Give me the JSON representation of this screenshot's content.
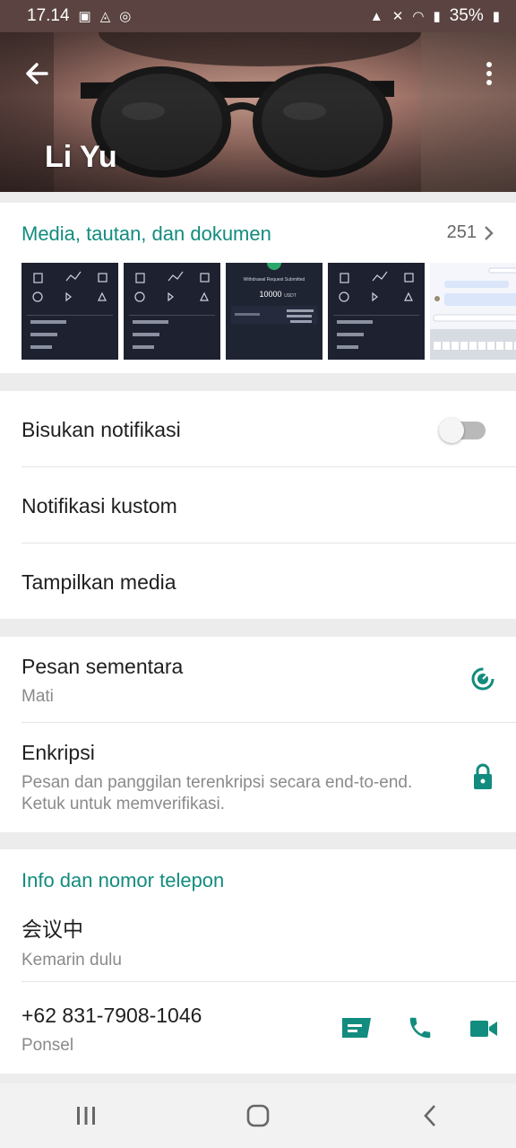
{
  "status_bar": {
    "time": "17.14",
    "battery": "35%"
  },
  "header": {
    "contact_name": "Li Yu"
  },
  "media": {
    "title": "Media, tautan, dan dokumen",
    "count": "251",
    "thumbnails": [
      {
        "kind": "dark-menu"
      },
      {
        "kind": "dark-menu"
      },
      {
        "kind": "withdrawal",
        "heading": "Withdrawal Request Submitted",
        "amount": "10000",
        "unit": "USDT"
      },
      {
        "kind": "dark-menu"
      },
      {
        "kind": "chat"
      }
    ]
  },
  "notifications": {
    "mute_label": "Bisukan notifikasi",
    "mute_on": false,
    "custom_label": "Notifikasi kustom",
    "show_media_label": "Tampilkan media"
  },
  "privacy": {
    "disappearing_label": "Pesan sementara",
    "disappearing_value": "Mati",
    "encryption_label": "Enkripsi",
    "encryption_desc": "Pesan dan panggilan terenkripsi secara end-to-end. Ketuk untuk memverifikasi."
  },
  "info": {
    "section_title": "Info dan nomor telepon",
    "about_text": "会议中",
    "about_date": "Kemarin dulu",
    "phone_number": "+62 831-7908-1046",
    "phone_type": "Ponsel"
  },
  "colors": {
    "accent": "#128c7e",
    "action_icon": "#128c7e"
  },
  "icons": {
    "back": "arrow-left-icon",
    "menu": "more-vertical-icon",
    "chevron": "chevron-right-icon",
    "timer": "timer-icon",
    "lock": "lock-icon",
    "message": "message-icon",
    "call": "phone-icon",
    "video": "video-icon"
  }
}
